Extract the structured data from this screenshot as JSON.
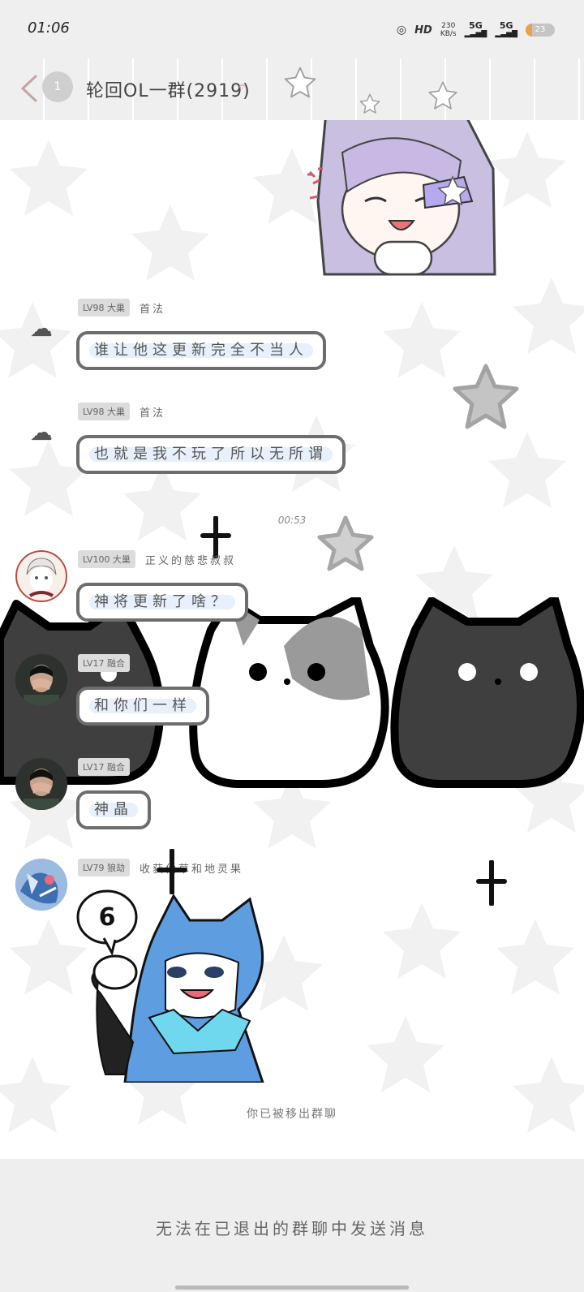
{
  "status_bar": {
    "time": "01:06",
    "hd_label": "HD",
    "net_speed": "230",
    "net_unit": "KB/s",
    "sim1": "5G",
    "sim2": "5G",
    "battery_level": "23",
    "battery_percent": 23
  },
  "header": {
    "unread_badge": "1",
    "group_title": "轮回OL一群(2919)",
    "back_icon": "chevron-left-icon",
    "ear_icon": "earpiece-icon"
  },
  "messages": [
    {
      "level": "LV98 大巢",
      "nick": "首法",
      "text": "谁让他这更新完全不当人"
    },
    {
      "level": "LV98 大巢",
      "nick": "首法",
      "text": "也就是我不玩了所以无所谓"
    },
    {
      "level": "LV100 大巢",
      "nick": "正义的慈悲叔叔",
      "text": "神将更新了啥？"
    },
    {
      "level": "LV17 融合",
      "nick": "",
      "text": "和你们一样"
    },
    {
      "level": "LV17 融合",
      "nick": "",
      "text": "神晶"
    },
    {
      "level": "LV79 狼劫",
      "nick": "收获仙草和地灵果",
      "sticker_text": "6"
    }
  ],
  "time_divider": "00:53",
  "system_note": "你已被移出群聊",
  "footer": {
    "notice": "无法在已退出的群聊中发送消息"
  },
  "colors": {
    "bubble_border": "#6d6d6d",
    "bubble_highlight": "#e7f0fb",
    "battery_fill": "#e9a14a",
    "header_bg": "#efefef"
  }
}
